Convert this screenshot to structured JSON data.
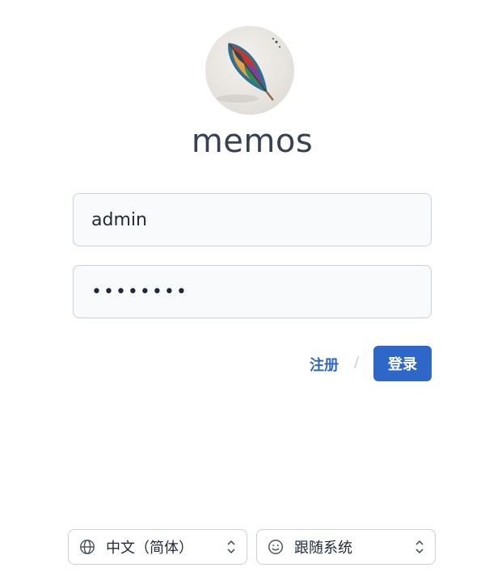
{
  "app": {
    "name": "memos"
  },
  "login_form": {
    "username_value": "admin",
    "password_value": "••••••••"
  },
  "actions": {
    "signup_label": "注册",
    "separator": "/",
    "login_label": "登录"
  },
  "footer": {
    "language": {
      "icon": "globe-icon",
      "selected": "中文（简体）"
    },
    "theme": {
      "icon": "smiley-icon",
      "selected": "跟随系统"
    }
  },
  "colors": {
    "primary": "#2f67c9",
    "border": "#c9d0da",
    "input_bg": "#f9fafc",
    "text": "#1f2937"
  }
}
